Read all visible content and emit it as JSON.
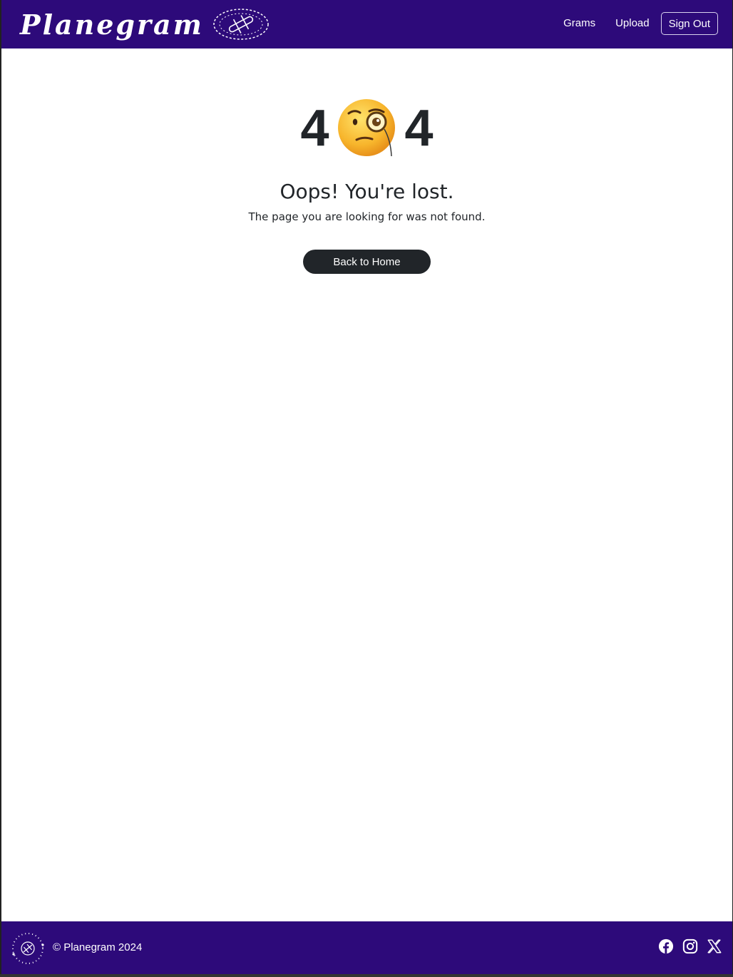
{
  "header": {
    "brand": "Planegram",
    "nav": {
      "grams": "Grams",
      "upload": "Upload",
      "sign_out": "Sign Out"
    }
  },
  "error": {
    "code_first": "4",
    "code_last": "4",
    "emoji_icon": "face-with-monocle-icon",
    "title": "Oops! You're lost.",
    "message": "The page you are looking for was not found.",
    "button": "Back to Home"
  },
  "footer": {
    "copyright": "© Planegram 2024",
    "social_icons": [
      "facebook-icon",
      "instagram-icon",
      "x-icon"
    ]
  },
  "colors": {
    "brand_purple": "#2d0a7a",
    "button_dark": "#212529",
    "text_dark": "#212529"
  }
}
